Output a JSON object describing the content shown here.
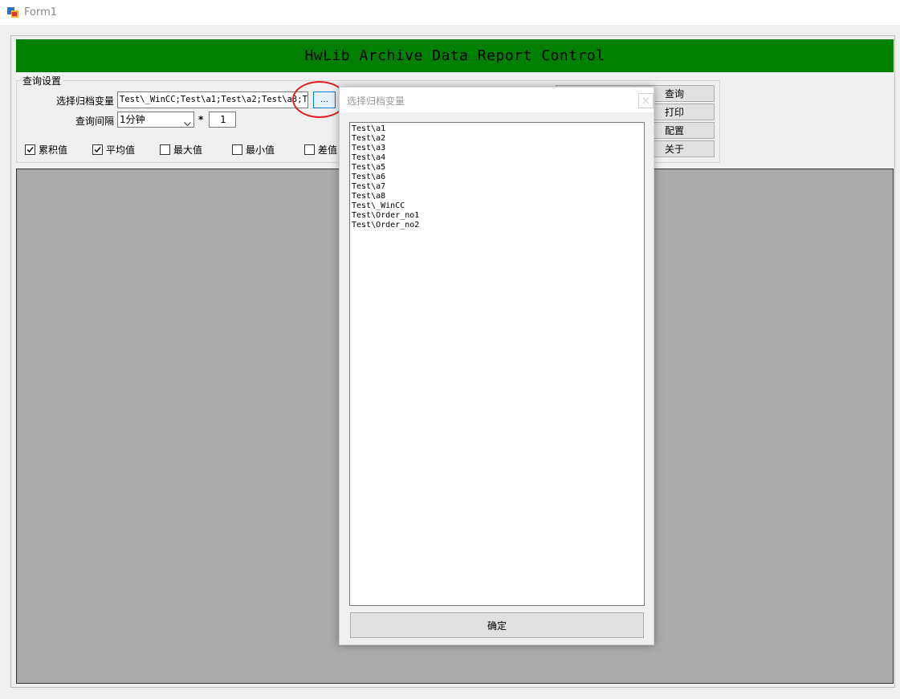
{
  "window": {
    "title": "Form1"
  },
  "header": {
    "title": "HwLib Archive Data Report Control"
  },
  "settings": {
    "group_title": "查询设置",
    "archive_var_label": "选择归档变量",
    "archive_var_value": "Test\\_WinCC;Test\\a1;Test\\a2;Test\\a3;Tes",
    "browse_label": "...",
    "interval_label": "查询间隔",
    "interval_value": "1分钟",
    "multiplier_symbol": "*",
    "multiplier_value": "1",
    "checkboxes": [
      {
        "label": "累积值",
        "checked": true
      },
      {
        "label": "平均值",
        "checked": true
      },
      {
        "label": "最大值",
        "checked": false
      },
      {
        "label": "最小值",
        "checked": false
      },
      {
        "label": "差值",
        "checked": false
      }
    ]
  },
  "actions": {
    "query": "查询",
    "print": "打印",
    "config": "配置",
    "about": "关于"
  },
  "dialog": {
    "title": "选择归档变量",
    "items": [
      "Test\\a1",
      "Test\\a2",
      "Test\\a3",
      "Test\\a4",
      "Test\\a5",
      "Test\\a6",
      "Test\\a7",
      "Test\\a8",
      "Test\\_WinCC",
      "Test\\Order_no1",
      "Test\\Order_no2"
    ],
    "ok_label": "确定"
  },
  "colors": {
    "header_bg": "#008000",
    "report_area_bg": "#ababab",
    "highlight_circle": "#e0201a"
  }
}
